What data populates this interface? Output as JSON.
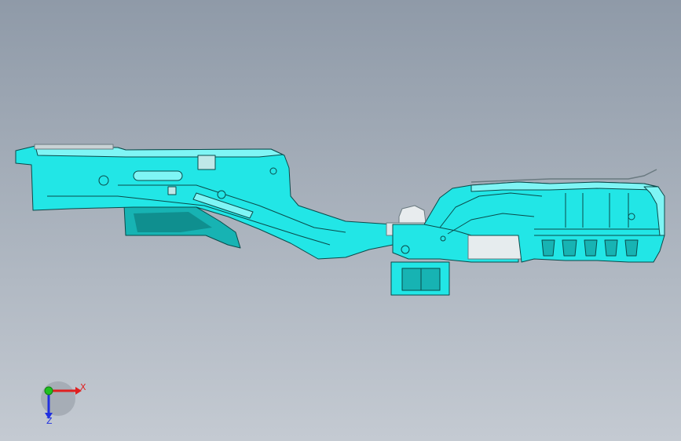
{
  "viewport": {
    "background_top": "#8f9aa8",
    "background_bottom": "#c4cad2"
  },
  "model": {
    "body_color": "#22e6e6",
    "edge_color": "#0a4a4a",
    "highlight_color": "#7ff5f5"
  },
  "triad": {
    "x_label": "X",
    "z_label": "Z",
    "x_color": "#e02020",
    "y_color": "#20c020",
    "z_color": "#2030e0"
  }
}
